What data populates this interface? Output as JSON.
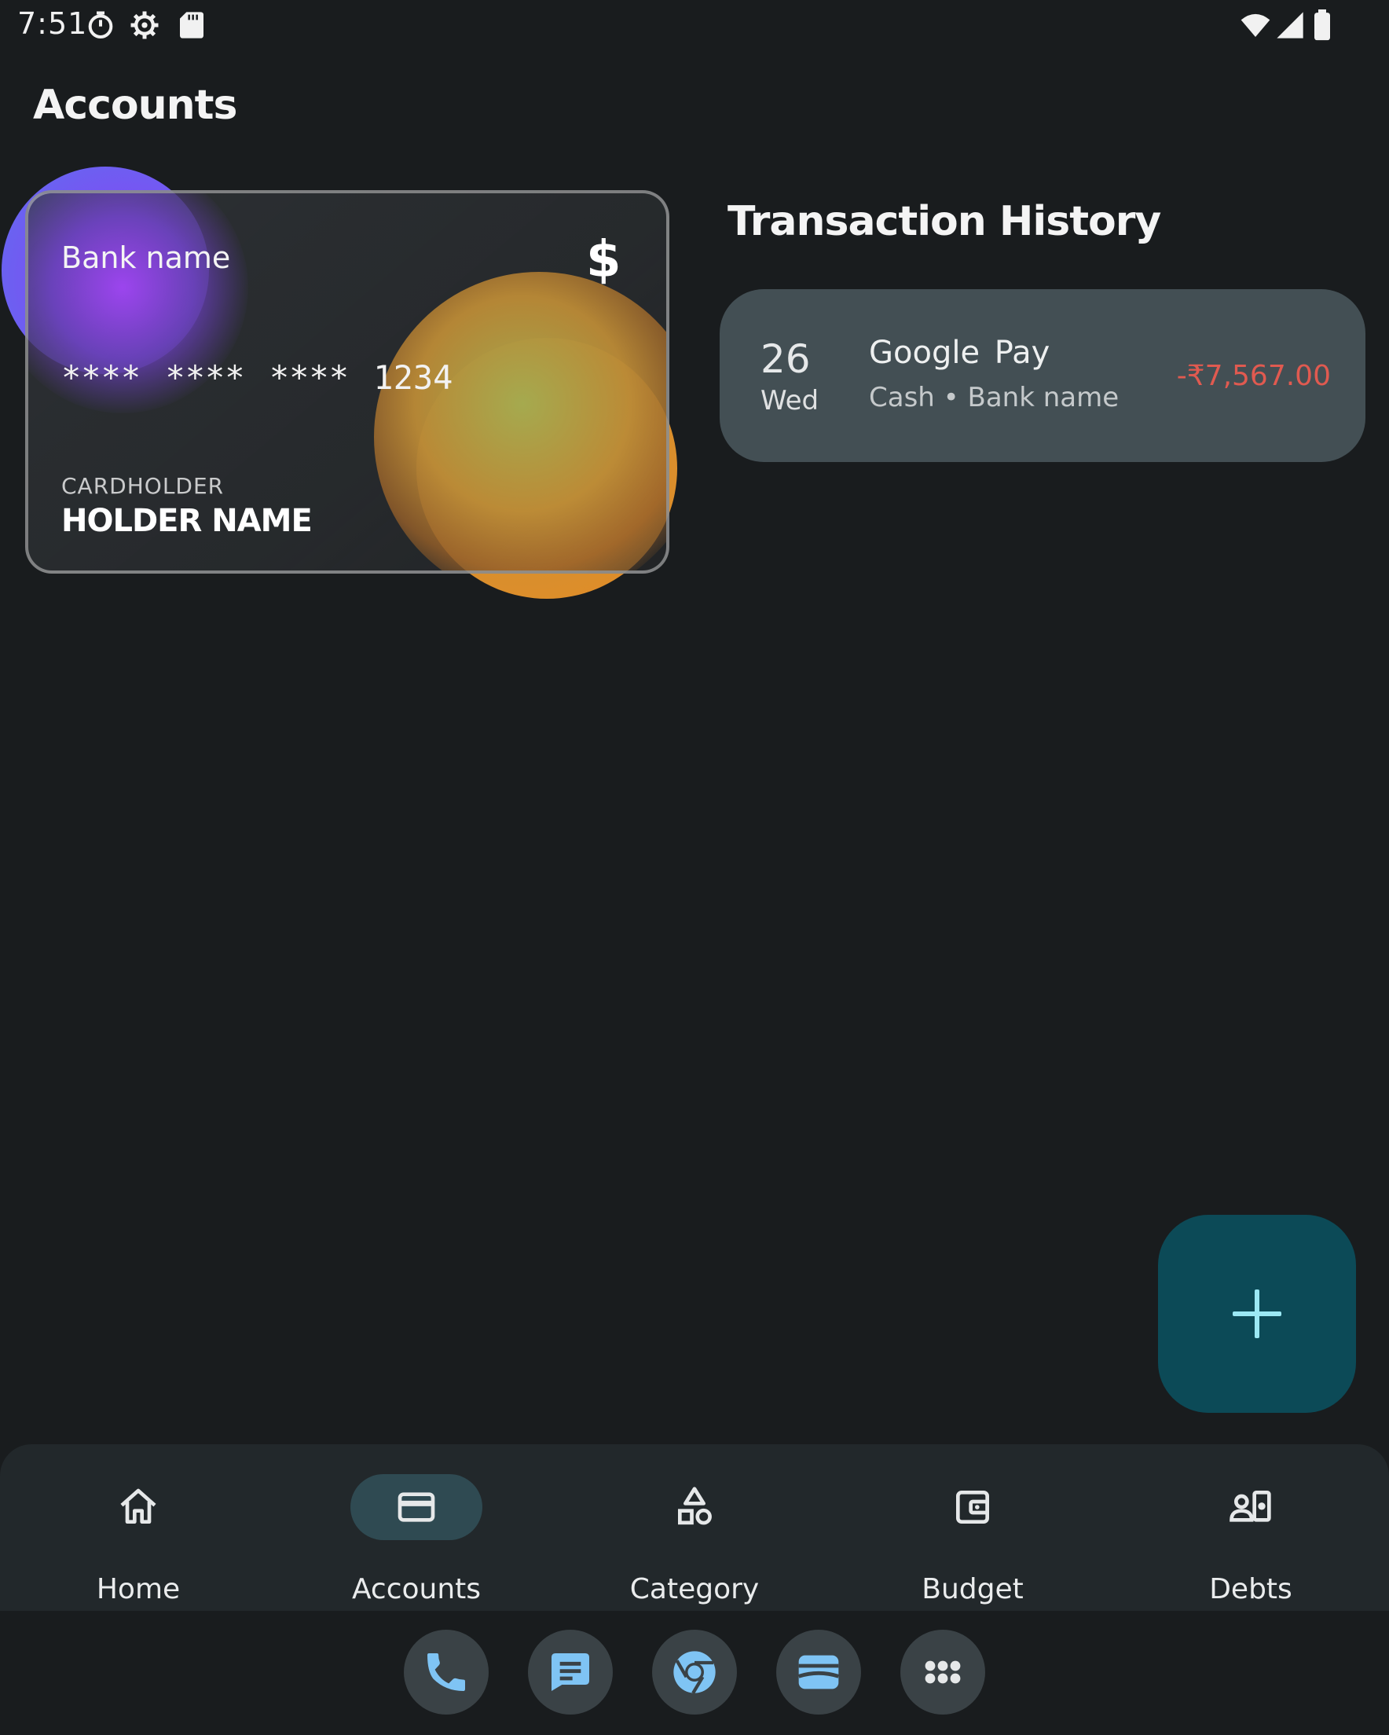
{
  "status_bar": {
    "time": "7:51",
    "icons": [
      "stopwatch-icon",
      "settings-gear-icon",
      "sd-card-icon",
      "wifi-icon",
      "cell-signal-icon",
      "battery-icon"
    ]
  },
  "page_title": "Accounts",
  "card": {
    "bank_name": "Bank name",
    "currency_symbol": "$",
    "number": "**** **** **** 1234",
    "holder_label": "CARDHOLDER",
    "holder_name": "HOLDER NAME",
    "accent_colors": {
      "purple": "#9b44f5",
      "orange": "#e68a24"
    }
  },
  "transactions": {
    "title": "Transaction History",
    "items": [
      {
        "day": "26",
        "weekday": "Wed",
        "title": "Google Pay",
        "subtitle": "Cash • Bank name",
        "amount": "-₹7,567.00",
        "amount_color": "#e05a50"
      }
    ]
  },
  "fab": {
    "icon": "plus-icon",
    "background": "#0c4a57"
  },
  "bottom_nav": {
    "items": [
      {
        "label": "Home",
        "icon": "home-icon",
        "active": false
      },
      {
        "label": "Accounts",
        "icon": "credit-card-icon",
        "active": true
      },
      {
        "label": "Category",
        "icon": "shapes-icon",
        "active": false
      },
      {
        "label": "Budget",
        "icon": "wallet-icon",
        "active": false
      },
      {
        "label": "Debts",
        "icon": "person-money-icon",
        "active": false
      }
    ]
  },
  "dock": {
    "apps": [
      "phone-icon",
      "messages-icon",
      "chrome-icon",
      "wallet-app-icon",
      "app-drawer-icon"
    ]
  }
}
